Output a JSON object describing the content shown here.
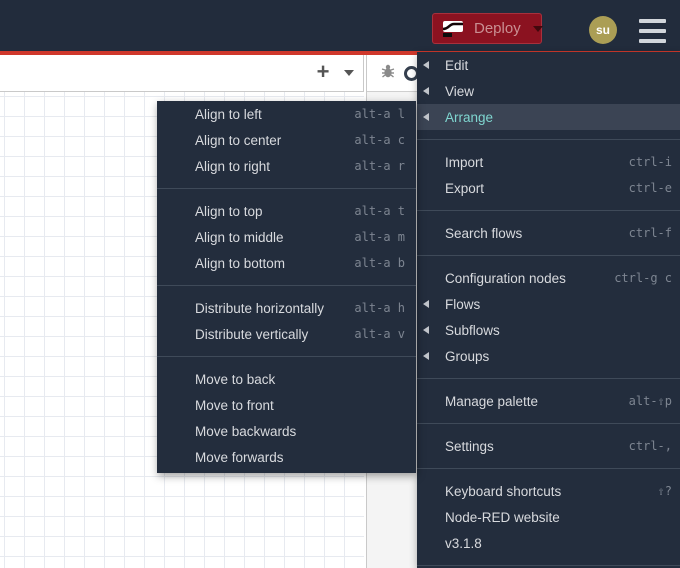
{
  "header": {
    "deploy_label": "Deploy",
    "user_initials": "su",
    "icons": {
      "deploy": "deploy-node-icon",
      "deploy_caret": "caret-down-icon",
      "menu": "hamburger-icon"
    },
    "colors": {
      "header_bg": "#222c3c",
      "accent_line": "#cf382c",
      "deploy_bg": "#8b1220",
      "avatar_bg": "#ab9e55"
    }
  },
  "workspace": {
    "icons": {
      "add_flow": "plus-icon",
      "flow_list": "caret-down-icon",
      "debug_tab": "bug-icon",
      "config_tab": "ring-icon"
    }
  },
  "main_menu": {
    "active_item": "Arrange",
    "colors": {
      "menu_bg": "#232d3d",
      "active_bg": "#3b4454",
      "active_text": "#7fd6d0"
    },
    "items": [
      {
        "type": "item",
        "label": "Edit",
        "shortcut": "",
        "has_submenu": true
      },
      {
        "type": "item",
        "label": "View",
        "shortcut": "",
        "has_submenu": true
      },
      {
        "type": "item",
        "label": "Arrange",
        "shortcut": "",
        "has_submenu": true,
        "active": true
      },
      {
        "type": "divider"
      },
      {
        "type": "item",
        "label": "Import",
        "shortcut": "ctrl-i"
      },
      {
        "type": "item",
        "label": "Export",
        "shortcut": "ctrl-e"
      },
      {
        "type": "divider"
      },
      {
        "type": "item",
        "label": "Search flows",
        "shortcut": "ctrl-f"
      },
      {
        "type": "divider"
      },
      {
        "type": "item",
        "label": "Configuration nodes",
        "shortcut": "ctrl-g c"
      },
      {
        "type": "item",
        "label": "Flows",
        "shortcut": "",
        "has_submenu": true
      },
      {
        "type": "item",
        "label": "Subflows",
        "shortcut": "",
        "has_submenu": true
      },
      {
        "type": "item",
        "label": "Groups",
        "shortcut": "",
        "has_submenu": true
      },
      {
        "type": "divider"
      },
      {
        "type": "item",
        "label": "Manage palette",
        "shortcut": "alt-⇧p"
      },
      {
        "type": "divider"
      },
      {
        "type": "item",
        "label": "Settings",
        "shortcut": "ctrl-,"
      },
      {
        "type": "divider"
      },
      {
        "type": "item",
        "label": "Keyboard shortcuts",
        "shortcut": "⇧?"
      },
      {
        "type": "item",
        "label": "Node-RED website",
        "shortcut": ""
      },
      {
        "type": "item",
        "label": "v3.1.8",
        "shortcut": ""
      },
      {
        "type": "divider"
      }
    ]
  },
  "arrange_submenu": {
    "items": [
      {
        "type": "item",
        "label": "Align to left",
        "shortcut": "alt-a l"
      },
      {
        "type": "item",
        "label": "Align to center",
        "shortcut": "alt-a c"
      },
      {
        "type": "item",
        "label": "Align to right",
        "shortcut": "alt-a r"
      },
      {
        "type": "divider"
      },
      {
        "type": "item",
        "label": "Align to top",
        "shortcut": "alt-a t"
      },
      {
        "type": "item",
        "label": "Align to middle",
        "shortcut": "alt-a m"
      },
      {
        "type": "item",
        "label": "Align to bottom",
        "shortcut": "alt-a b"
      },
      {
        "type": "divider"
      },
      {
        "type": "item",
        "label": "Distribute horizontally",
        "shortcut": "alt-a h"
      },
      {
        "type": "item",
        "label": "Distribute vertically",
        "shortcut": "alt-a v"
      },
      {
        "type": "divider"
      },
      {
        "type": "item",
        "label": "Move to back",
        "shortcut": ""
      },
      {
        "type": "item",
        "label": "Move to front",
        "shortcut": ""
      },
      {
        "type": "item",
        "label": "Move backwards",
        "shortcut": ""
      },
      {
        "type": "item",
        "label": "Move forwards",
        "shortcut": ""
      }
    ]
  }
}
